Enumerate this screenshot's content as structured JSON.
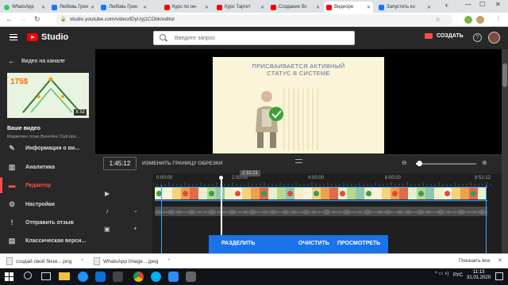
{
  "browser": {
    "tabs": [
      {
        "label": "WhatsApp",
        "icon": "whatsapp-icon"
      },
      {
        "label": "Любовь Грен",
        "icon": "facebook-icon"
      },
      {
        "label": "Любовь Грен",
        "icon": "facebook-icon"
      },
      {
        "label": "Курс по он-",
        "icon": "youtube-icon"
      },
      {
        "label": "Курс Таргет",
        "icon": "youtube-icon"
      },
      {
        "label": "Создание бл",
        "icon": "youtube-icon"
      },
      {
        "label": "Видеоре",
        "icon": "youtube-icon",
        "active": true
      },
      {
        "label": "Запустить ко",
        "icon": "facebook-icon"
      }
    ],
    "url": "studio.youtube.com/video/lDyUyj1CDbk/editor"
  },
  "header": {
    "logo_text": "Studio",
    "search_placeholder": "Введите запрос",
    "create_label": "СОЗДАТЬ"
  },
  "sidebar": {
    "back_label": "Видео на канале",
    "thumb_price": "175$",
    "thumb_duration": "8:52",
    "your_video_label": "Ваше видео",
    "video_title": "Маркетинг план Beverlee Club про...",
    "items": [
      {
        "label": "Информация о ви...",
        "icon": "pencil-icon",
        "glyph": "✎"
      },
      {
        "label": "Аналитика",
        "icon": "analytics-icon",
        "glyph": "▥"
      },
      {
        "label": "Редактор",
        "icon": "editor-icon",
        "glyph": "▬",
        "active": true
      },
      {
        "label": "Настройки",
        "icon": "gear-icon",
        "glyph": "⚙"
      },
      {
        "label": "Отправить отзыв",
        "icon": "feedback-icon",
        "glyph": "!"
      },
      {
        "label": "Классическая верси...",
        "icon": "classic-icon",
        "glyph": "▤"
      }
    ]
  },
  "preview": {
    "caption_line1": "ПРИСВАИВАЕТСЯ АКТИВНЫЙ",
    "caption_line2": "СТАТУС В СИСТЕМЕ"
  },
  "toolbar": {
    "current_time": "1:45:12",
    "trim_label": "ИЗМЕНИТЬ ГРАНИЦУ ОБРЕЗКИ",
    "zoom_level": 0.05
  },
  "timeline": {
    "ruler": [
      "0:00:00",
      "2:00:00",
      "4:00:00",
      "6:00:00",
      "8:51:12"
    ],
    "playhead_time": "2:31:21"
  },
  "actions": {
    "split": "РАЗДЕЛИТЬ",
    "clear": "ОЧИСТИТЬ",
    "view": "ПРОСМОТРЕТЬ"
  },
  "downloads": {
    "items": [
      "создай свой бизн....png",
      "WhatsApp Image....jpeg"
    ],
    "show_all": "Показать все"
  },
  "taskbar": {
    "lang": "РУС",
    "time": "11:13",
    "date": "31.01.2020"
  },
  "colors": {
    "accent_red": "#ff4e45",
    "accent_blue": "#1a73e8",
    "studio_dark": "#282828"
  }
}
